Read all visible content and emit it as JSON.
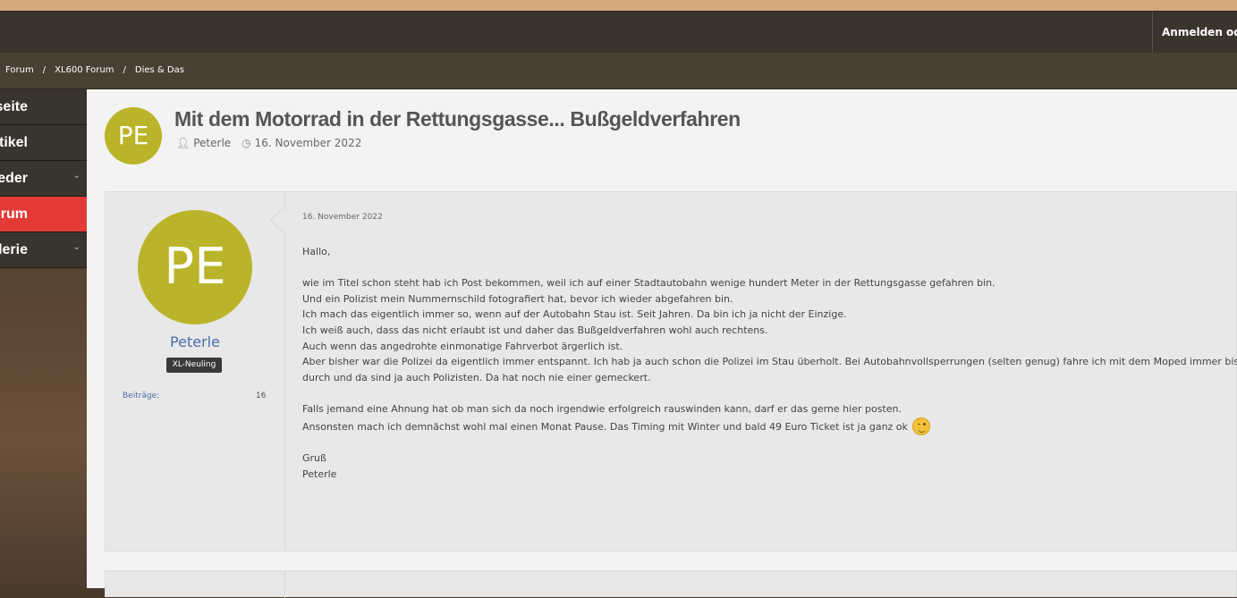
{
  "header": {
    "login_label": "Anmelden oder"
  },
  "breadcrumb": {
    "items": [
      "Forum",
      "XL600 Forum",
      "Dies & Das"
    ],
    "separator": "/"
  },
  "sidebar": {
    "items": [
      {
        "label": "Startseite",
        "active": false,
        "has_submenu": false
      },
      {
        "label": "Artikel",
        "active": false,
        "has_submenu": false
      },
      {
        "label": "Mitglieder",
        "active": false,
        "has_submenu": true
      },
      {
        "label": "Forum",
        "active": true,
        "has_submenu": false
      },
      {
        "label": "Galerie",
        "active": false,
        "has_submenu": true
      }
    ],
    "active_color": "#e23b36"
  },
  "thread": {
    "avatar_initials": "PE",
    "avatar_color": "#bab42a",
    "title": "Mit dem Motorrad in der Rettungsgasse... Bußgeldverfahren",
    "author": "Peterle",
    "date": "16. November 2022",
    "author_icon": "user-icon",
    "date_icon": "clock-icon"
  },
  "post": {
    "avatar_initials": "PE",
    "username": "Peterle",
    "rank": "XL-Neuling",
    "stat_label": "Beiträge:",
    "stat_value": "16",
    "date": "16. November 2022",
    "greeting": "Hallo,",
    "paragraph1": [
      "wie im Titel schon steht hab ich Post bekommen, weil ich auf einer Stadtautobahn wenige hundert Meter in der Rettungsgasse gefahren bin.",
      "Und ein Polizist mein Nummernschild fotografiert hat, bevor ich wieder abgefahren bin.",
      "Ich mach das eigentlich immer so, wenn auf der Autobahn Stau ist. Seit Jahren. Da bin ich ja nicht der Einzige.",
      "Ich weiß auch, dass das nicht erlaubt ist und daher das Bußgeldverfahren wohl auch rechtens.",
      "Auch wenn das angedrohte einmonatige Fahrverbot ärgerlich ist.",
      "Aber bisher war die Polizei da eigentlich immer entspannt. Ich hab ja auch schon die Polizei im Stau überholt. Bei Autobahnvollsperrungen (selten genug) fahre ich mit dem Moped immer bis",
      "durch und da sind ja auch Polizisten. Da hat noch nie einer gemeckert."
    ],
    "paragraph2": [
      "Falls jemand eine Ahnung hat ob man sich da noch irgendwie erfolgreich rauswinden kann, darf er das gerne hier posten.",
      "Ansonsten mach ich demnächst wohl mal einen Monat Pause. Das Timing mit Winter und bald 49 Euro Ticket ist ja ganz ok"
    ],
    "emoji": "wink-smiley-icon",
    "closing": [
      "Gruß",
      "Peterle"
    ]
  }
}
